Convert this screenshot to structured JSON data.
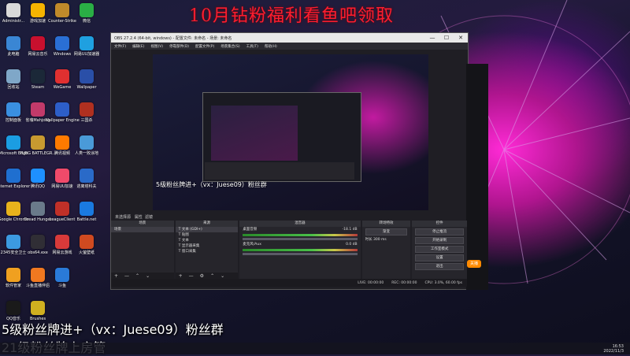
{
  "banner": {
    "title": "10月钻粉福利看鱼吧领取"
  },
  "overlay": {
    "line1": "5级粉丝牌进+（vx：Juese09）粉丝群",
    "line2": "21级粉丝牌上房管"
  },
  "desktop_icons": [
    {
      "label": "Administr...",
      "color": "#d9d9d9"
    },
    {
      "label": "游戏加速",
      "color": "#f5b400"
    },
    {
      "label": "Counter-Strike",
      "color": "#c08a2a"
    },
    {
      "label": "微信",
      "color": "#2aae45"
    },
    {
      "label": "此电脑",
      "color": "#3a86d4"
    },
    {
      "label": "网易云音乐",
      "color": "#c8102e"
    },
    {
      "label": "Windows",
      "color": "#2a6fd4"
    },
    {
      "label": "网易UU加速器",
      "color": "#1fa0e0"
    },
    {
      "label": "回收站",
      "color": "#7fa7c8"
    },
    {
      "label": "Steam",
      "color": "#1b2838"
    },
    {
      "label": "WeGame",
      "color": "#e03030"
    },
    {
      "label": "Wallpaper",
      "color": "#2a4fa8"
    },
    {
      "label": "控制面板",
      "color": "#3a8fe0"
    },
    {
      "label": "雀魂Mahjong",
      "color": "#c23a6a"
    },
    {
      "label": "Wallpaper Engine",
      "color": "#2d5ec8"
    },
    {
      "label": "三国杀",
      "color": "#b03020"
    },
    {
      "label": "Microsoft Edge",
      "color": "#1b9de2"
    },
    {
      "label": "PUBG BATTLEGR...",
      "color": "#c89a30"
    },
    {
      "label": "腾讯视频",
      "color": "#ff7a00"
    },
    {
      "label": "人类一败涂地",
      "color": "#4a9ad8"
    },
    {
      "label": "Internet Explorer",
      "color": "#1f6fd0"
    },
    {
      "label": "腾讯QQ",
      "color": "#1e90ff"
    },
    {
      "label": "网易UU加速",
      "color": "#f04a6a"
    },
    {
      "label": "逃离塔科夫",
      "color": "#2a6ac8"
    },
    {
      "label": "Google Chrome",
      "color": "#e8b21c"
    },
    {
      "label": "Dread Hunger",
      "color": "#6a7a8a"
    },
    {
      "label": "LeagueClient",
      "color": "#c03028"
    },
    {
      "label": "Battle.net",
      "color": "#1a7ae0"
    },
    {
      "label": "2345安全卫士",
      "color": "#3c9ae0"
    },
    {
      "label": "obs64.exe",
      "color": "#302e35"
    },
    {
      "label": "网易云游戏",
      "color": "#d83a3a"
    },
    {
      "label": "火萤壁纸",
      "color": "#d04a20"
    },
    {
      "label": "软件管家",
      "color": "#f0a020"
    },
    {
      "label": "斗鱼直播伴侣",
      "color": "#f07820"
    },
    {
      "label": "斗鱼",
      "color": "#2a7ad8"
    },
    {
      "label": "QQ音乐",
      "color": "#1a1a1a"
    },
    {
      "label": "Brushes",
      "color": "#d0b020"
    }
  ],
  "obs": {
    "title": "OBS 27.2.4 (64-bit, windows) - 配置文件: 未命名 - 场景: 未命名",
    "menu": [
      "文件(F)",
      "编辑(E)",
      "视图(V)",
      "停靠部件(D)",
      "配置文件(P)",
      "场景集合(S)",
      "工具(T)",
      "帮助(H)"
    ],
    "minimize": "—",
    "maximize": "☐",
    "close": "✕",
    "no_source": "未选择源",
    "properties_btn": "属性",
    "filters_btn": "滤镜",
    "docks": {
      "scenes": {
        "header": "场景",
        "items": [
          "场景"
        ]
      },
      "sources": {
        "header": "来源",
        "items": [
          "文本 (GDI+)",
          "贴图",
          "文本",
          "显示器采集",
          "窗口采集"
        ]
      },
      "mixer": {
        "header": "混音器",
        "channels": [
          {
            "name": "桌面音频",
            "db": "-18.1 dB"
          },
          {
            "name": "麦克风/Aux",
            "db": "0.0 dB"
          }
        ]
      },
      "transitions": {
        "header": "转场特效",
        "fade": "渐变",
        "duration_label": "时长",
        "duration": "300 ms"
      },
      "controls": {
        "header": "控件",
        "buttons": [
          "停止推流",
          "开始录制",
          "工作室模式",
          "设置",
          "退出"
        ]
      }
    },
    "footer_plus": "+",
    "footer_minus": "—",
    "footer_up": "⌃",
    "footer_down": "⌄",
    "footer_gear": "⚙",
    "status": {
      "live": "LIVE: 00:00:00",
      "rec": "REC: 00:00:00",
      "cpu": "CPU: 3.0%, 60.00 fps"
    }
  },
  "orange_btn": "关播",
  "taskbar": {
    "time": "16:53",
    "date": "2022/11/3"
  },
  "preview_text": "5级粉丝牌进+（vx：Juese09）粉丝群"
}
